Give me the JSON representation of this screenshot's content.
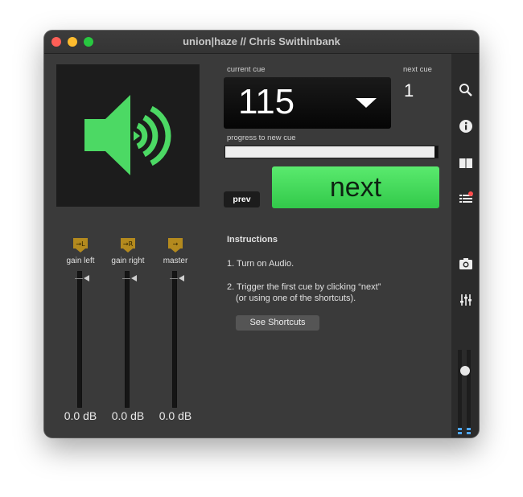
{
  "window": {
    "title": "union|haze // Chris Swithinbank"
  },
  "cue": {
    "current_label": "current cue",
    "current_value": "115",
    "next_label": "next cue",
    "next_value": "1",
    "progress_label": "progress to new cue",
    "progress": 0.0
  },
  "buttons": {
    "prev": "prev",
    "next": "next",
    "shortcuts": "See Shortcuts"
  },
  "instructions": {
    "title": "Instructions",
    "step1": "1. Turn on Audio.",
    "step2a": "2. Trigger the first cue by clicking “next”",
    "step2b": "(or using one of the shortcuts)."
  },
  "channels": [
    {
      "label": "gain left",
      "badge": "→L",
      "db": "0.0 dB"
    },
    {
      "label": "gain right",
      "badge": "→R",
      "db": "0.0 dB"
    },
    {
      "label": "master",
      "badge": "→",
      "db": "0.0 dB"
    }
  ],
  "sidebar_icons": [
    "search-icon",
    "info-icon",
    "book-icon",
    "list-notification-icon",
    "camera-icon",
    "mixer-sliders-icon"
  ],
  "colors": {
    "accent_green": "#4cd964",
    "background": "#3a3a3a",
    "meter_blue": "#4ea6ff"
  }
}
